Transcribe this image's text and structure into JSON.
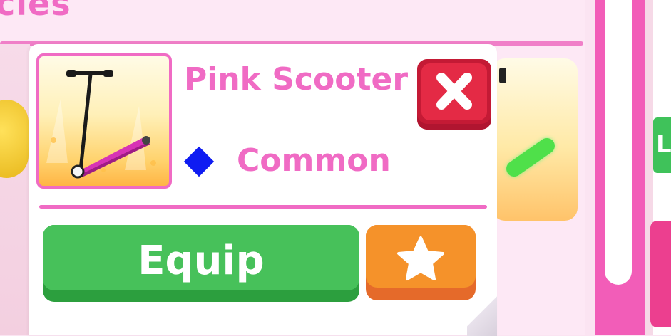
{
  "background": {
    "section_title_fragment": "cles",
    "right_edge_letter": "L"
  },
  "item_popup": {
    "item_name": "Pink Scooter",
    "rarity": {
      "label": "Common",
      "icon": "blue-diamond-icon",
      "color": "#0f1cf2"
    },
    "close_button": {
      "icon": "close-x-icon",
      "color": "#e42a45"
    },
    "equip_button": {
      "label": "Equip",
      "color": "#47c15a"
    },
    "favorite_button": {
      "icon": "star-icon",
      "color": "#f5922a"
    },
    "accent_color": "#f06bc4"
  }
}
